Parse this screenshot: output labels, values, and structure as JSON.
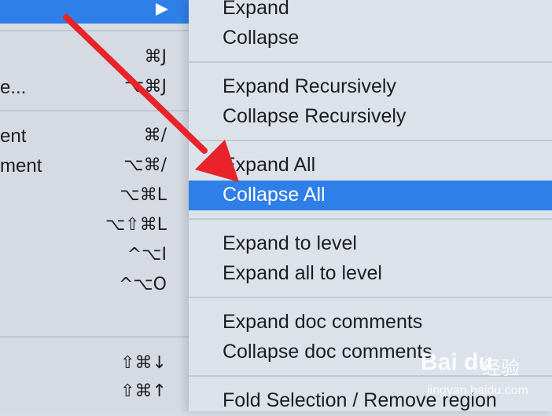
{
  "left_menu": {
    "items": [
      {
        "label": "",
        "shortcut": "⌘J"
      },
      {
        "label": "e...",
        "shortcut": "⌥⌘J"
      },
      {
        "label": "ent",
        "shortcut": "⌘/"
      },
      {
        "label": "ment",
        "shortcut": "⌥⌘/"
      },
      {
        "label": "",
        "shortcut": "⌥⌘L"
      },
      {
        "label": "",
        "shortcut": "⌥⇧⌘L"
      },
      {
        "label": "",
        "shortcut": "^⌥I"
      },
      {
        "label": "",
        "shortcut": "^⌥O"
      },
      {
        "label": "",
        "shortcut": "⇧⌘↓"
      },
      {
        "label": "",
        "shortcut": "⇧⌘↑"
      }
    ]
  },
  "folding_menu": {
    "items": [
      {
        "label": "Expand"
      },
      {
        "label": "Collapse"
      },
      {
        "label": "Expand Recursively"
      },
      {
        "label": "Collapse Recursively"
      },
      {
        "label": "Expand All"
      },
      {
        "label": "Collapse All"
      },
      {
        "label": "Expand to level"
      },
      {
        "label": "Expand all to level"
      },
      {
        "label": "Expand doc comments"
      },
      {
        "label": "Collapse doc comments"
      },
      {
        "label": "Fold Selection / Remove region"
      }
    ],
    "selected": "Collapse All"
  },
  "watermark": {
    "logo": "Bai du",
    "name": "经验",
    "url": "jingyan.baidu.com"
  },
  "colors": {
    "highlight": "#2f7fe8",
    "arrow": "#e8232a"
  }
}
